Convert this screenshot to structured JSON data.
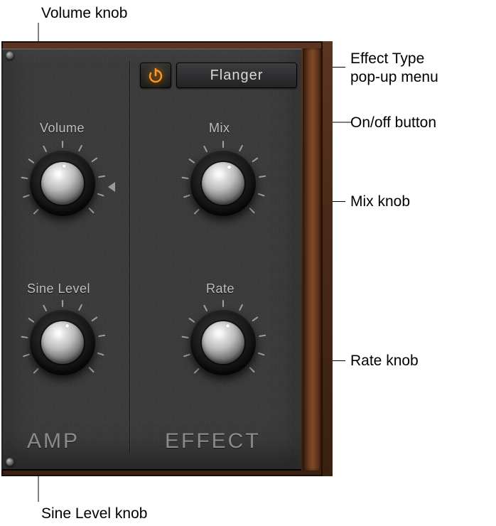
{
  "callouts": {
    "volume": "Volume knob",
    "effect_type": "Effect Type\npop-up menu",
    "onoff": "On/off button",
    "mix": "Mix knob",
    "rate": "Rate knob",
    "sine": "Sine Level knob"
  },
  "toolbar": {
    "effect_value": "Flanger",
    "power_on": true
  },
  "panel": {
    "labels": {
      "volume": "Volume",
      "sine": "Sine Level",
      "mix": "Mix",
      "rate": "Rate"
    },
    "sections": {
      "amp": "AMP",
      "effect": "EFFECT"
    }
  },
  "knob_values": {
    "volume_angle": -10,
    "sine_angle": 0,
    "mix_angle": 5,
    "rate_angle": 0
  }
}
